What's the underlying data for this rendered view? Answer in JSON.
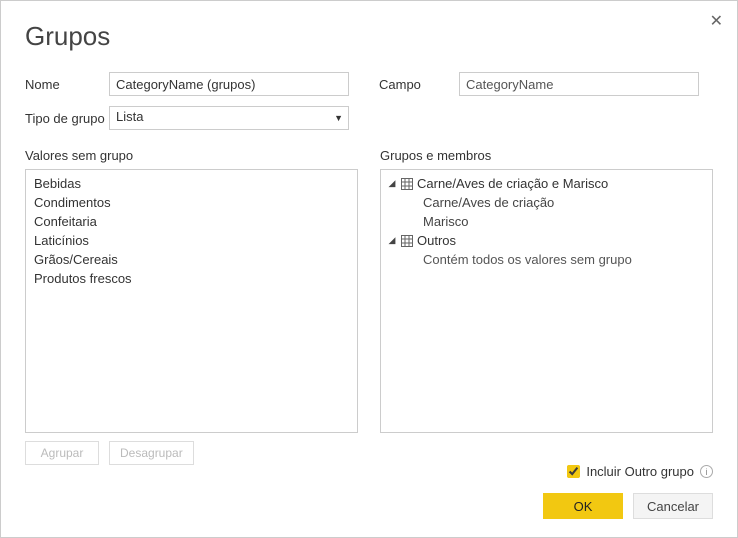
{
  "title": "Grupos",
  "form": {
    "name_label": "Nome",
    "name_value": "CategoryName (grupos)",
    "field_label": "Campo",
    "field_value": "CategoryName",
    "type_label": "Tipo de grupo",
    "type_value": "Lista"
  },
  "ungrouped": {
    "title": "Valores sem grupo",
    "items": [
      "Bebidas",
      "Condimentos",
      "Confeitaria",
      "Laticínios",
      "Grãos/Cereais",
      "Produtos frescos"
    ]
  },
  "groups": {
    "title": "Grupos e membros",
    "nodes": [
      {
        "label": "Carne/Aves de criação e Marisco",
        "children": [
          "Carne/Aves de criação",
          "Marisco"
        ]
      },
      {
        "label": "Outros",
        "desc": "Contém todos os valores sem grupo"
      }
    ]
  },
  "buttons": {
    "group": "Agrupar",
    "ungroup": "Desagrupar",
    "ok": "OK",
    "cancel": "Cancelar"
  },
  "include_other": {
    "checked": true,
    "label": "Incluir Outro grupo"
  }
}
